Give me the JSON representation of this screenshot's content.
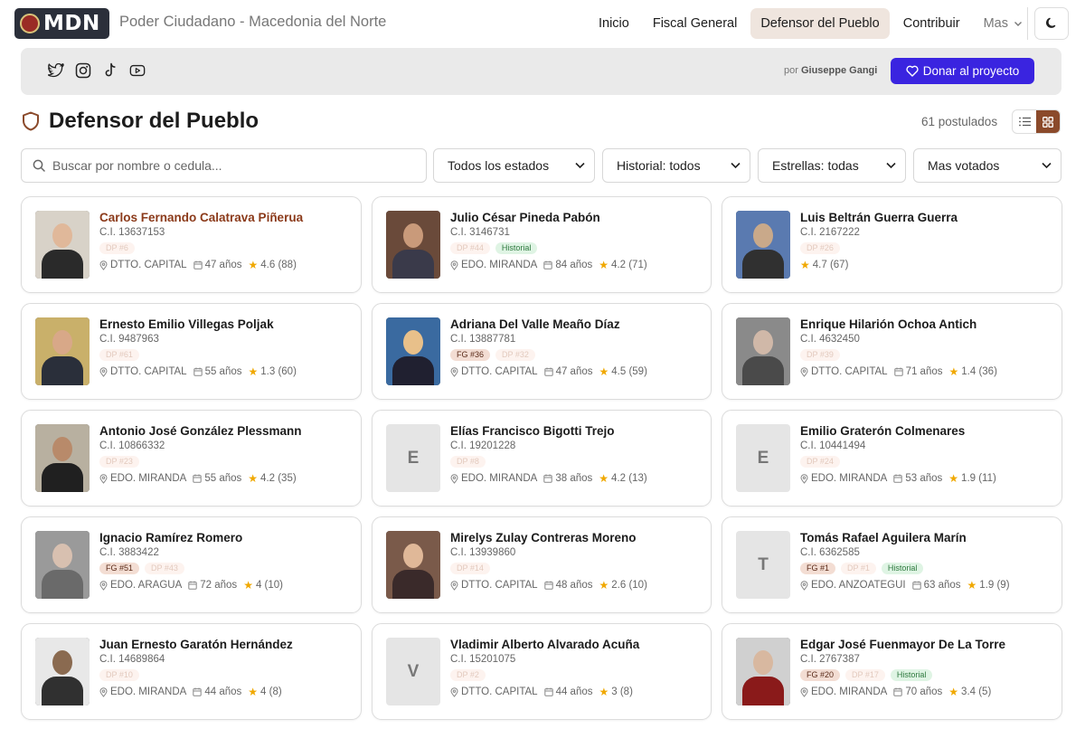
{
  "header": {
    "logo_text": "MDN",
    "site_title": "Poder Ciudadano - Macedonia del Norte",
    "nav": [
      "Inicio",
      "Fiscal General",
      "Defensor del Pueblo",
      "Contribuir"
    ],
    "more_label": "Mas",
    "active_nav": "Defensor del Pueblo"
  },
  "social": {
    "icons": [
      "twitter-icon",
      "instagram-icon",
      "tiktok-icon",
      "youtube-icon"
    ],
    "byline_prefix": "por",
    "byline_author": "Giuseppe Gangi",
    "donate_label": "Donar al proyecto"
  },
  "page": {
    "title": "Defensor del Pueblo",
    "count_label": "61 postulados"
  },
  "filters": {
    "search_placeholder": "Buscar por nombre o cedula...",
    "estado": "Todos los estados",
    "historial": "Historial: todos",
    "estrellas": "Estrellas: todas",
    "orden": "Mas votados"
  },
  "colors": {
    "accent": "#8b4a2b",
    "donate": "#3a24e0",
    "star": "#f0a800",
    "historial_bg": "#dff4e4"
  },
  "candidates": [
    {
      "name": "Carlos Fernando Calatrava Piñerua",
      "ci": "C.I. 13637153",
      "tags": [
        {
          "t": "DP #6",
          "k": "dp"
        }
      ],
      "location": "DTTO. CAPITAL",
      "age": "47 años",
      "rating": "4.6 (88)",
      "photo": "img",
      "highlight": true
    },
    {
      "name": "Julio César Pineda Pabón",
      "ci": "C.I. 3146731",
      "tags": [
        {
          "t": "DP #44",
          "k": "dp"
        },
        {
          "t": "Historial",
          "k": "hist"
        }
      ],
      "location": "EDO. MIRANDA",
      "age": "84 años",
      "rating": "4.2 (71)",
      "photo": "img"
    },
    {
      "name": "Luis Beltrán Guerra Guerra",
      "ci": "C.I. 2167222",
      "tags": [
        {
          "t": "DP #26",
          "k": "dp"
        }
      ],
      "location": "",
      "age": "",
      "rating": "4.7 (67)",
      "photo": "img"
    },
    {
      "name": "Ernesto Emilio Villegas Poljak",
      "ci": "C.I. 9487963",
      "tags": [
        {
          "t": "DP #61",
          "k": "dp"
        }
      ],
      "location": "DTTO. CAPITAL",
      "age": "55 años",
      "rating": "1.3 (60)",
      "photo": "img"
    },
    {
      "name": "Adriana Del Valle Meaño Díaz",
      "ci": "C.I. 13887781",
      "tags": [
        {
          "t": "FG #36",
          "k": "fg"
        },
        {
          "t": "DP #32",
          "k": "dp"
        }
      ],
      "location": "DTTO. CAPITAL",
      "age": "47 años",
      "rating": "4.5 (59)",
      "photo": "img"
    },
    {
      "name": "Enrique Hilarión Ochoa Antich",
      "ci": "C.I. 4632450",
      "tags": [
        {
          "t": "DP #39",
          "k": "dp"
        }
      ],
      "location": "DTTO. CAPITAL",
      "age": "71 años",
      "rating": "1.4 (36)",
      "photo": "img"
    },
    {
      "name": "Antonio José González Plessmann",
      "ci": "C.I. 10866332",
      "tags": [
        {
          "t": "DP #23",
          "k": "dp"
        }
      ],
      "location": "EDO. MIRANDA",
      "age": "55 años",
      "rating": "4.2 (35)",
      "photo": "img"
    },
    {
      "name": "Elías Francisco Bigotti Trejo",
      "ci": "C.I. 19201228",
      "tags": [
        {
          "t": "DP #8",
          "k": "dp"
        }
      ],
      "location": "EDO. MIRANDA",
      "age": "38 años",
      "rating": "4.2 (13)",
      "photo": "initial",
      "initial": "E"
    },
    {
      "name": "Emilio Graterón Colmenares",
      "ci": "C.I. 10441494",
      "tags": [
        {
          "t": "DP #24",
          "k": "dp"
        }
      ],
      "location": "EDO. MIRANDA",
      "age": "53 años",
      "rating": "1.9 (11)",
      "photo": "initial",
      "initial": "E"
    },
    {
      "name": "Ignacio Ramírez Romero",
      "ci": "C.I. 3883422",
      "tags": [
        {
          "t": "FG #51",
          "k": "fg"
        },
        {
          "t": "DP #43",
          "k": "dp"
        }
      ],
      "location": "EDO. ARAGUA",
      "age": "72 años",
      "rating": "4 (10)",
      "photo": "img"
    },
    {
      "name": "Mirelys Zulay Contreras Moreno",
      "ci": "C.I. 13939860",
      "tags": [
        {
          "t": "DP #14",
          "k": "dp"
        }
      ],
      "location": "DTTO. CAPITAL",
      "age": "48 años",
      "rating": "2.6 (10)",
      "photo": "img"
    },
    {
      "name": "Tomás Rafael Aguilera Marín",
      "ci": "C.I. 6362585",
      "tags": [
        {
          "t": "FG #1",
          "k": "fg"
        },
        {
          "t": "DP #1",
          "k": "dp"
        },
        {
          "t": "Historial",
          "k": "hist"
        }
      ],
      "location": "EDO. ANZOATEGUI",
      "age": "63 años",
      "rating": "1.9 (9)",
      "photo": "initial",
      "initial": "T"
    },
    {
      "name": "Juan Ernesto Garatón Hernández",
      "ci": "C.I. 14689864",
      "tags": [
        {
          "t": "DP #10",
          "k": "dp"
        }
      ],
      "location": "EDO. MIRANDA",
      "age": "44 años",
      "rating": "4 (8)",
      "photo": "img"
    },
    {
      "name": "Vladimir Alberto Alvarado Acuña",
      "ci": "C.I. 15201075",
      "tags": [
        {
          "t": "DP #2",
          "k": "dp"
        }
      ],
      "location": "DTTO. CAPITAL",
      "age": "44 años",
      "rating": "3 (8)",
      "photo": "initial",
      "initial": "V"
    },
    {
      "name": "Edgar José Fuenmayor De La Torre",
      "ci": "C.I. 2767387",
      "tags": [
        {
          "t": "FG #20",
          "k": "fg"
        },
        {
          "t": "DP #17",
          "k": "dp"
        },
        {
          "t": "Historial",
          "k": "hist"
        }
      ],
      "location": "EDO. MIRANDA",
      "age": "70 años",
      "rating": "3.4 (5)",
      "photo": "img"
    }
  ]
}
